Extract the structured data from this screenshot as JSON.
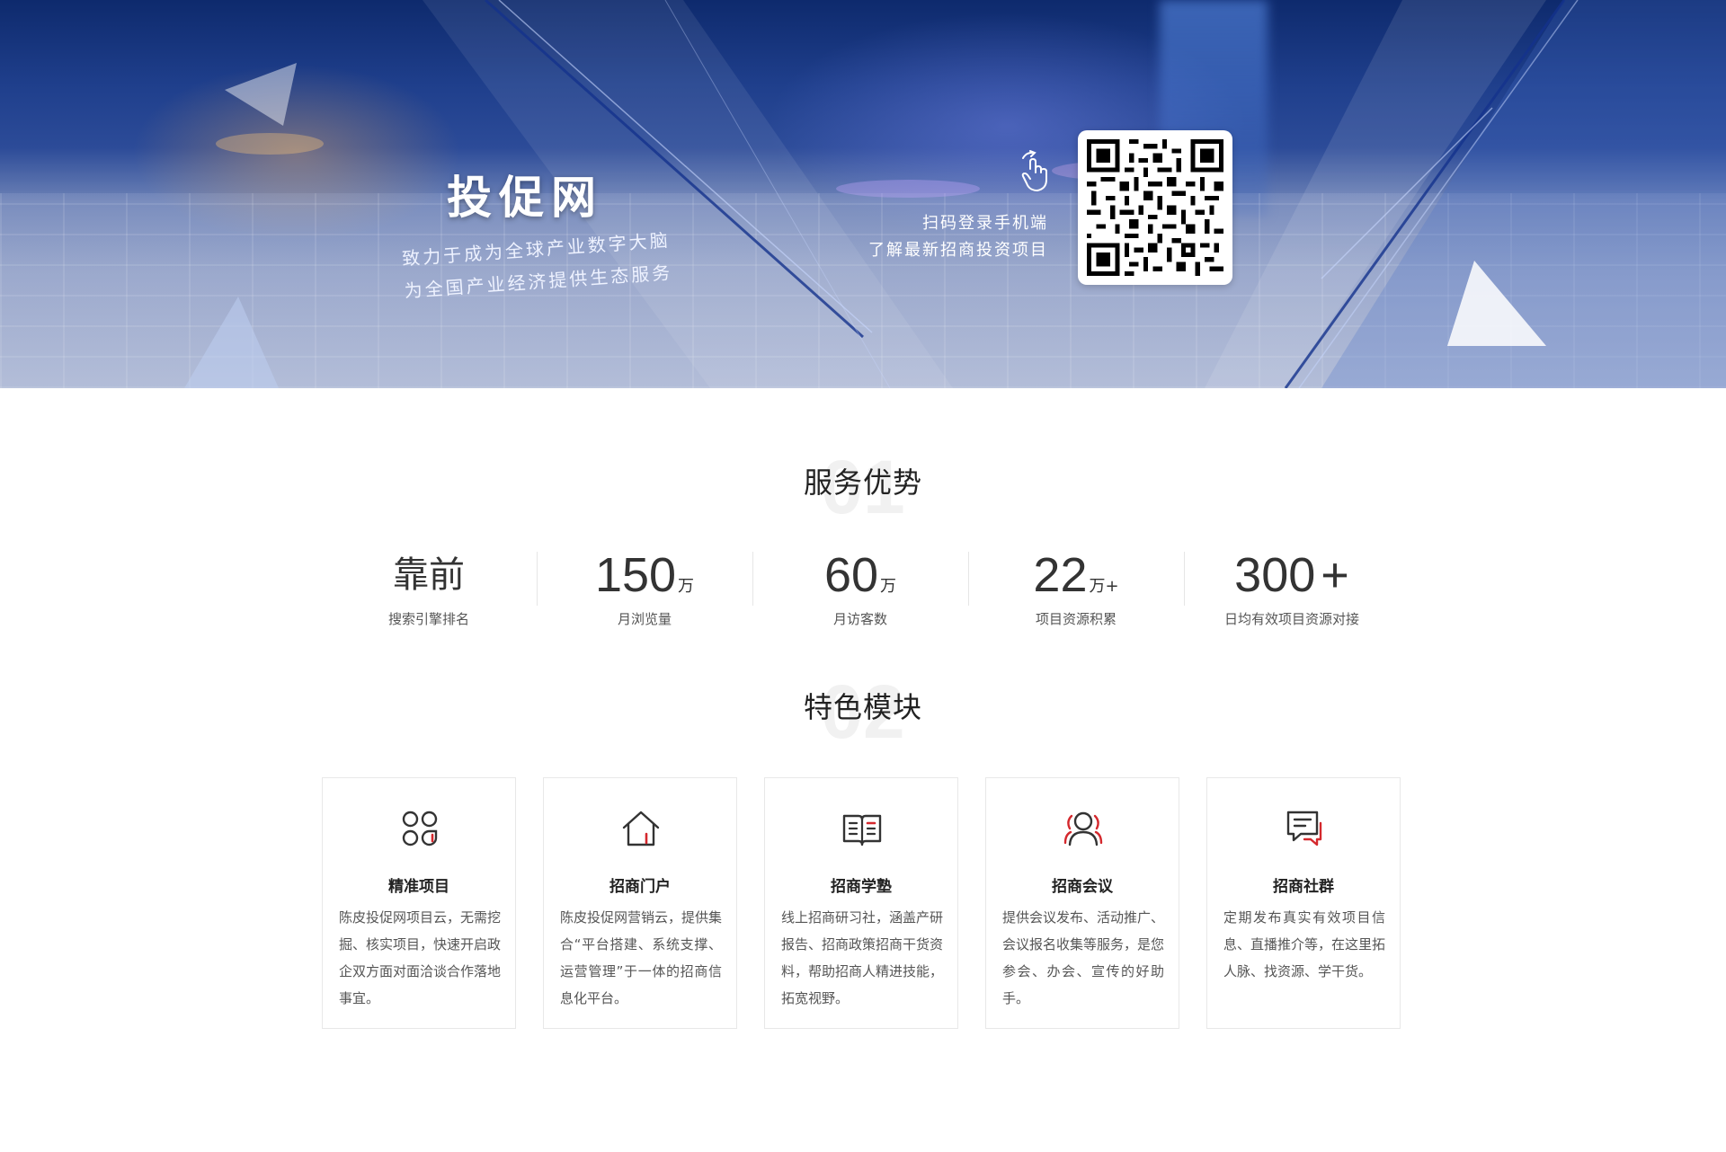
{
  "hero": {
    "title": "投促网",
    "slogan_line1": "致力于成为全球产业数字大脑",
    "slogan_line2": "为全国产业经济提供生态服务",
    "scan_line1": "扫码登录手机端",
    "scan_line2": "了解最新招商投资项目"
  },
  "advantages": {
    "number": "01",
    "title": "服务优势",
    "stats": [
      {
        "value": "靠前",
        "unit": "",
        "label": "搜索引擎排名"
      },
      {
        "value": "150",
        "unit": "万",
        "label": "月浏览量"
      },
      {
        "value": "60",
        "unit": "万",
        "label": "月访客数"
      },
      {
        "value": "22",
        "unit": "万+",
        "label": "项目资源积累"
      },
      {
        "value": "300",
        "unit": "+",
        "label": "日均有效项目资源对接"
      }
    ]
  },
  "features": {
    "number": "02",
    "title": "特色模块",
    "cards": [
      {
        "icon": "grid-icon",
        "title": "精准项目",
        "desc": "陈皮投促网项目云，无需挖掘、核实项目，快速开启政企双方面对面洽谈合作落地事宜。"
      },
      {
        "icon": "home-icon",
        "title": "招商门户",
        "desc": "陈皮投促网营销云，提供集合“平台搭建、系统支撑、运营管理”于一体的招商信息化平台。"
      },
      {
        "icon": "book-icon",
        "title": "招商学塾",
        "desc": "线上招商研习社，涵盖产研报告、招商政策招商干货资料，帮助招商人精进技能，拓宽视野。"
      },
      {
        "icon": "users-icon",
        "title": "招商会议",
        "desc": "提供会议发布、活动推广、会议报名收集等服务，是您参会、办会、宣传的好助手。"
      },
      {
        "icon": "chat-icon",
        "title": "招商社群",
        "desc": "定期发布真实有效项目信息、直播推介等，在这里拓人脉、找资源、学干货。"
      }
    ]
  },
  "colors": {
    "accent": "#d4282d",
    "icon": "#333333"
  }
}
